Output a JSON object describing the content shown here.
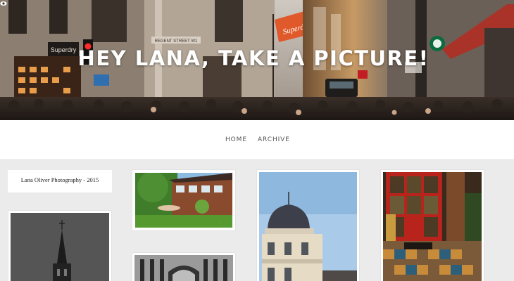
{
  "header": {
    "site_title": "HEY LANA, TAKE A PICTURE!",
    "banner_sign": "Superdry",
    "shop_sign": "Superdry",
    "street_sign": "REGENT STREET W1"
  },
  "nav": {
    "items": [
      {
        "label": "HOME"
      },
      {
        "label": "ARCHIVE"
      }
    ]
  },
  "sidebar": {
    "caption": "Lana Oliver Photography - 2015"
  },
  "gallery": {
    "photos": [
      {
        "subject": "house-garden-photo"
      },
      {
        "subject": "church-spire-photo"
      },
      {
        "subject": "building-facade-photo"
      },
      {
        "subject": "dome-tower-photo"
      },
      {
        "subject": "red-door-photo"
      }
    ]
  },
  "colors": {
    "page_bg": "#ebebeb",
    "nav_bg": "#ffffff",
    "title_text": "#ffffff",
    "flag_orange": "#e0592a"
  }
}
